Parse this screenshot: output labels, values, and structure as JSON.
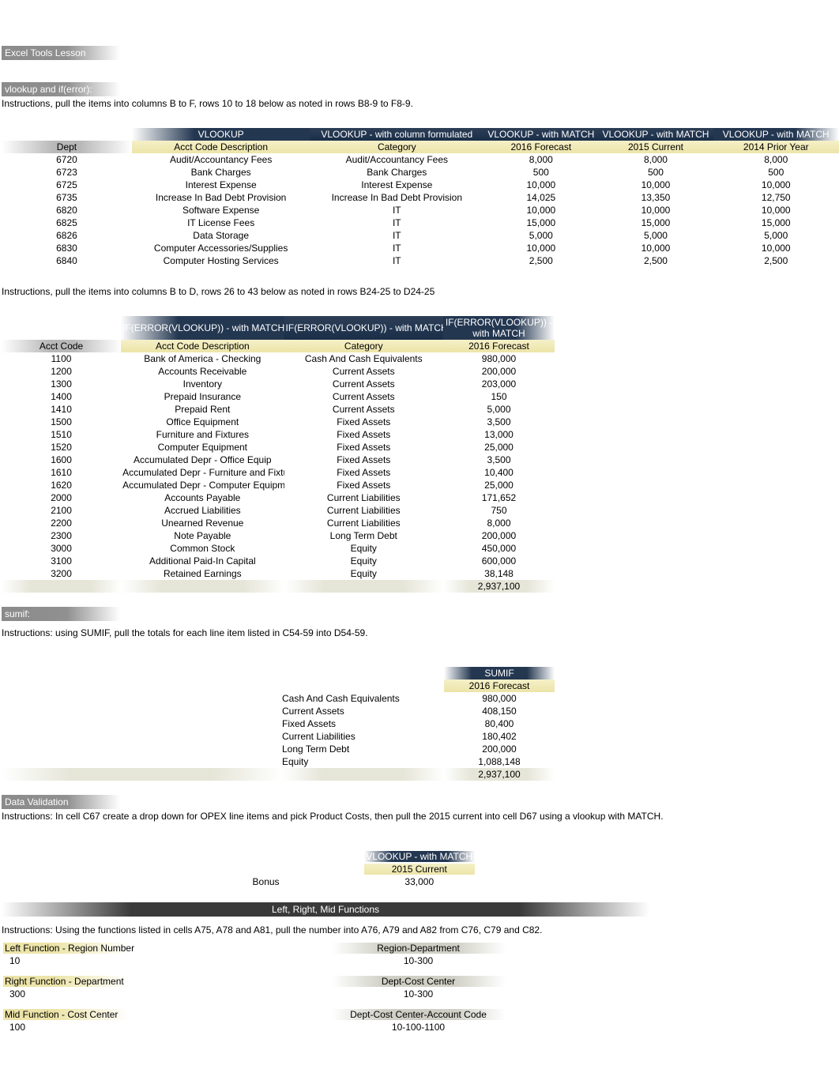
{
  "labels": {
    "excel_tools": "Excel Tools Lesson",
    "vlookup_iferror": "vlookup and if(error):",
    "sumif": "sumif:",
    "data_validation": "Data Validation",
    "lrm": "Left, Right, Mid Functions"
  },
  "instr": {
    "i1": "Instructions, pull the items into columns B to F, rows 10 to 18 below as noted in rows B8-9 to F8-9.",
    "i2": "Instructions, pull the items into columns B to D, rows 26 to 43 below as noted in rows B24-25 to D24-25",
    "i3": "Instructions: using SUMIF, pull the totals for each line item listed in C54-59 into D54-59.",
    "i4": "Instructions: In cell C67 create a drop down for OPEX line items and pick Product Costs, then pull the 2015 current into cell D67 using a vlookup with MATCH.",
    "i5": "Instructions: Using the functions listed in cells A75, A78 and A81, pull the number into A76, A79 and A82 from C76, C79 and C82."
  },
  "t1": {
    "h": [
      "",
      "VLOOKUP",
      "VLOOKUP - with column formulated",
      "VLOOKUP - with MATCH",
      "VLOOKUP - with MATCH",
      "VLOOKUP - with MATCH"
    ],
    "sh": [
      "Dept",
      "Acct Code Description",
      "Category",
      "2016 Forecast",
      "2015 Current",
      "2014 Prior Year"
    ],
    "rows": [
      [
        "6720",
        "Audit/Accountancy Fees",
        "Audit/Accountancy Fees",
        "8,000",
        "8,000",
        "8,000"
      ],
      [
        "6723",
        "Bank Charges",
        "Bank Charges",
        "500",
        "500",
        "500"
      ],
      [
        "6725",
        "Interest Expense",
        "Interest Expense",
        "10,000",
        "10,000",
        "10,000"
      ],
      [
        "6735",
        "Increase In Bad Debt Provision",
        "Increase In Bad Debt Provision",
        "14,025",
        "13,350",
        "12,750"
      ],
      [
        "6820",
        "Software Expense",
        "IT",
        "10,000",
        "10,000",
        "10,000"
      ],
      [
        "6825",
        "IT License Fees",
        "IT",
        "15,000",
        "15,000",
        "15,000"
      ],
      [
        "6826",
        "Data Storage",
        "IT",
        "5,000",
        "5,000",
        "5,000"
      ],
      [
        "6830",
        "Computer Accessories/Supplies",
        "IT",
        "10,000",
        "10,000",
        "10,000"
      ],
      [
        "6840",
        "Computer Hosting Services",
        "IT",
        "2,500",
        "2,500",
        "2,500"
      ]
    ]
  },
  "t2": {
    "h": [
      "",
      "IF(ERROR(VLOOKUP)) - with MATCH",
      "IF(ERROR(VLOOKUP)) - with MATCH",
      "IF(ERROR(VLOOKUP)) - with MATCH"
    ],
    "sh": [
      "Acct Code",
      "Acct Code Description",
      "Category",
      "2016 Forecast"
    ],
    "rows": [
      [
        "1100",
        "Bank of America - Checking",
        "Cash And Cash Equivalents",
        "980,000"
      ],
      [
        "1200",
        "Accounts Receivable",
        "Current Assets",
        "200,000"
      ],
      [
        "1300",
        "Inventory",
        "Current Assets",
        "203,000"
      ],
      [
        "1400",
        "Prepaid Insurance",
        "Current Assets",
        "150"
      ],
      [
        "1410",
        "Prepaid Rent",
        "Current Assets",
        "5,000"
      ],
      [
        "1500",
        "Office Equipment",
        "Fixed Assets",
        "3,500"
      ],
      [
        "1510",
        "Furniture and Fixtures",
        "Fixed Assets",
        "13,000"
      ],
      [
        "1520",
        "Computer Equipment",
        "Fixed Assets",
        "25,000"
      ],
      [
        "1600",
        "Accumulated Depr - Office Equip",
        "Fixed Assets",
        "3,500"
      ],
      [
        "1610",
        "Accumulated Depr - Furniture and Fixtures",
        "Fixed Assets",
        "10,400"
      ],
      [
        "1620",
        "Accumulated Depr - Computer Equipment",
        "Fixed Assets",
        "25,000"
      ],
      [
        "2000",
        "Accounts Payable",
        "Current Liabilities",
        "171,652"
      ],
      [
        "2100",
        "Accrued Liabilities",
        "Current Liabilities",
        "750"
      ],
      [
        "2200",
        "Unearned Revenue",
        "Current Liabilities",
        "8,000"
      ],
      [
        "2300",
        "Note Payable",
        "Long Term Debt",
        "200,000"
      ],
      [
        "3000",
        "Common Stock",
        "Equity",
        "450,000"
      ],
      [
        "3100",
        "Additional Paid-In Capital",
        "Equity",
        "600,000"
      ],
      [
        "3200",
        "Retained Earnings",
        "Equity",
        "38,148"
      ]
    ],
    "total": "2,937,100"
  },
  "t3": {
    "h": "SUMIF",
    "sh": "2016 Forecast",
    "rows": [
      [
        "Cash And Cash Equivalents",
        "980,000"
      ],
      [
        "Current Assets",
        "408,150"
      ],
      [
        "Fixed Assets",
        "80,400"
      ],
      [
        "Current Liabilities",
        "180,402"
      ],
      [
        "Long Term Debt",
        "200,000"
      ],
      [
        "Equity",
        "1,088,148"
      ]
    ],
    "total": "2,937,100"
  },
  "t4": {
    "h": "VLOOKUP - with MATCH",
    "sh": "2015 Current",
    "label": "Bonus",
    "value": "33,000"
  },
  "lrm": {
    "left_hdr": "Left Function - Region Number",
    "left_val": "10",
    "left_src_hdr": "Region-Department",
    "left_src_val": "10-300",
    "right_hdr": "Right Function - Department",
    "right_val": "300",
    "right_src_hdr": "Dept-Cost Center",
    "right_src_val": "10-300",
    "mid_hdr": "Mid Function - Cost Center",
    "mid_val": "100",
    "mid_src_hdr": "Dept-Cost Center-Account Code",
    "mid_src_val": "10-100-1100"
  }
}
